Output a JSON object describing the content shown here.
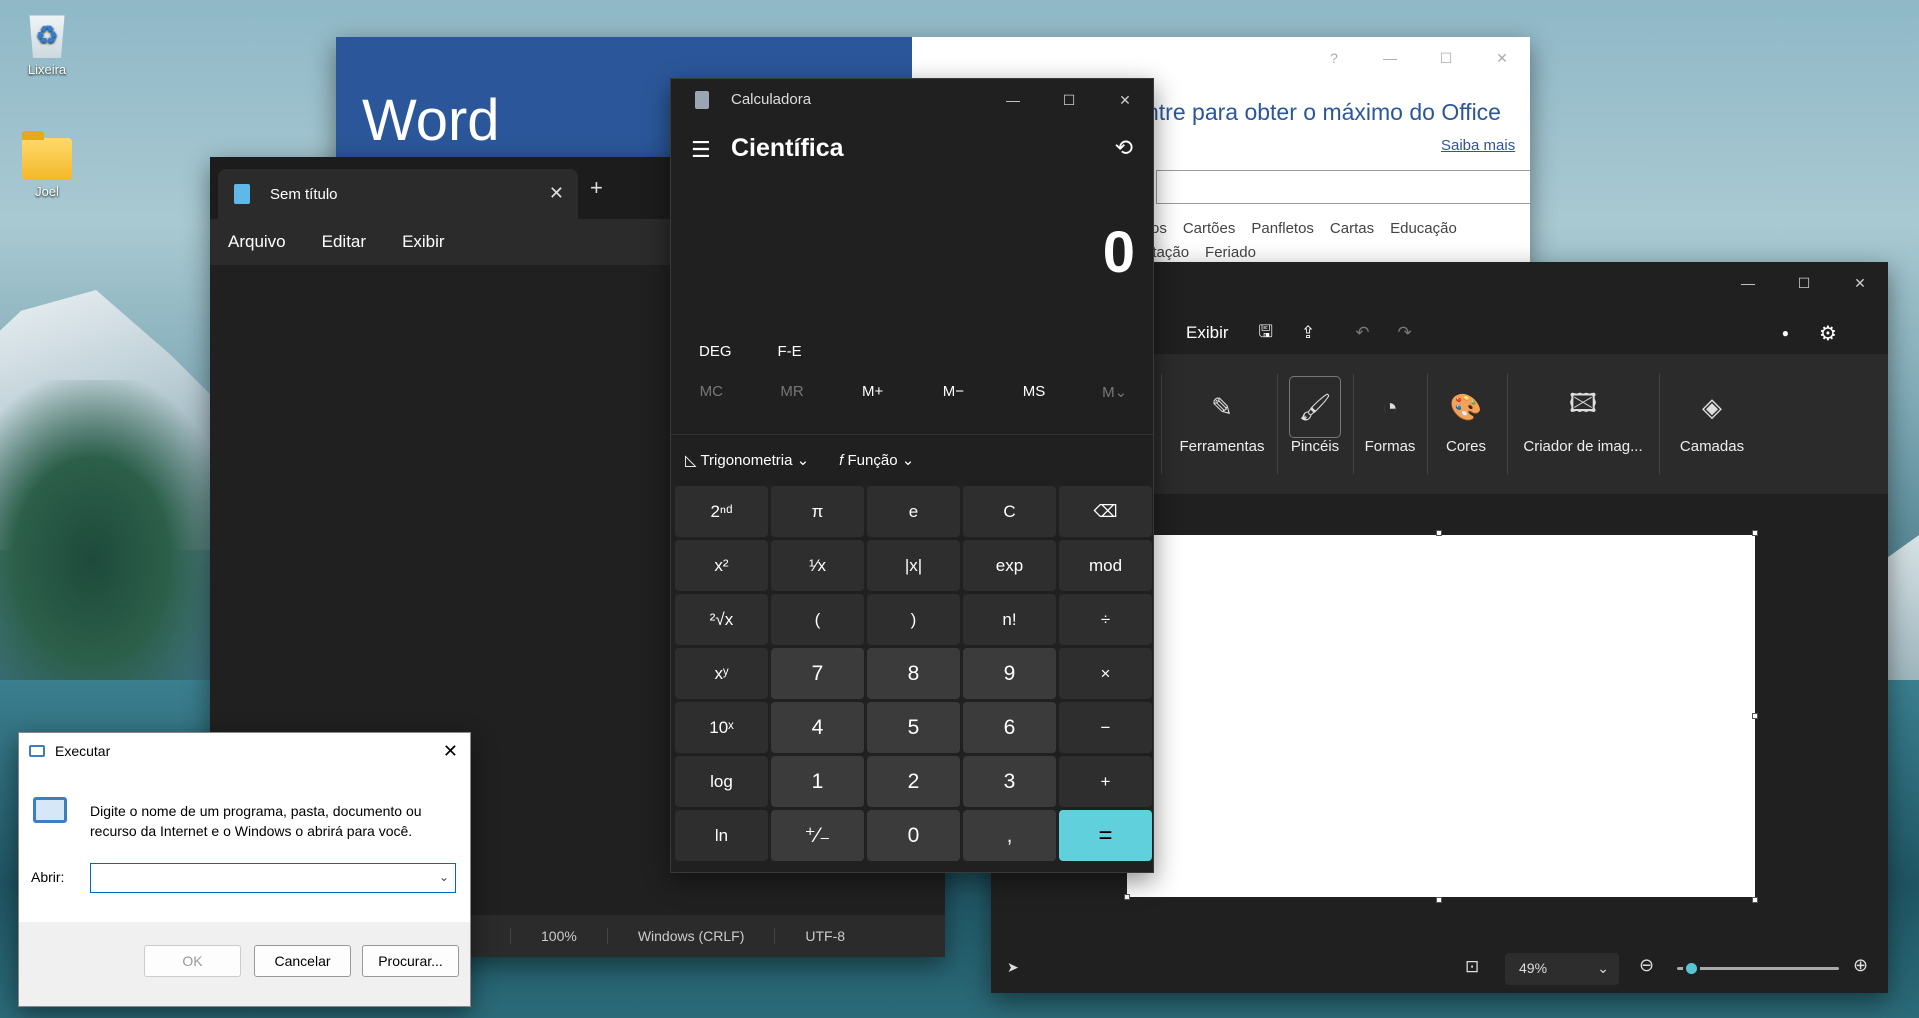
{
  "desktop": {
    "icons": [
      {
        "label": "Lixeira",
        "icon": "recycle-bin-icon"
      },
      {
        "label": "Joel",
        "icon": "folder-icon"
      }
    ]
  },
  "word": {
    "title": "Word",
    "promo_heading": "ntre para obter o máximo do Office",
    "learn_more": "Saiba mais",
    "help": "?",
    "categories_row1": [
      "os",
      "Cartões",
      "Panfletos",
      "Cartas",
      "Educação"
    ],
    "categories_row2": [
      "ntação",
      "Feriado"
    ]
  },
  "notepad": {
    "tab_title": "Sem título",
    "menu": [
      "Arquivo",
      "Editar",
      "Exibir"
    ],
    "status": {
      "zoom": "100%",
      "line_endings": "Windows (CRLF)",
      "encoding": "UTF-8"
    }
  },
  "calculator": {
    "title": "Calculadora",
    "mode": "Científica",
    "display": "0",
    "deg": "DEG",
    "fe": "F-E",
    "memory": [
      "MC",
      "MR",
      "M+",
      "M−",
      "MS",
      "M⌄"
    ],
    "trig": "Trigonometria",
    "func": "Função",
    "keys": [
      [
        "2ⁿᵈ",
        "π",
        "e",
        "C",
        "⌫"
      ],
      [
        "x²",
        "¹⁄x",
        "|x|",
        "exp",
        "mod"
      ],
      [
        "²√x",
        "(",
        ")",
        "n!",
        "÷"
      ],
      [
        "xʸ",
        "7",
        "8",
        "9",
        "×"
      ],
      [
        "10ˣ",
        "4",
        "5",
        "6",
        "−"
      ],
      [
        "log",
        "1",
        "2",
        "3",
        "+"
      ],
      [
        "ln",
        "⁺⁄₋",
        "0",
        ",",
        "="
      ]
    ]
  },
  "paint": {
    "view_menu": "Exibir",
    "tools": [
      "Ferramentas",
      "Pincéis",
      "Formas",
      "Cores",
      "Criador de imag...",
      "Camadas"
    ],
    "zoom": "49%",
    "zoom_level": 0.04
  },
  "run": {
    "title": "Executar",
    "description": "Digite o nome de um programa, pasta, documento ou recurso da Internet e o Windows o abrirá para você.",
    "open_label": "Abrir:",
    "open_value": "",
    "ok": "OK",
    "cancel": "Cancelar",
    "browse": "Procurar..."
  },
  "colors": {
    "accent": "#5fd0dc",
    "word_blue": "#2b579a"
  }
}
